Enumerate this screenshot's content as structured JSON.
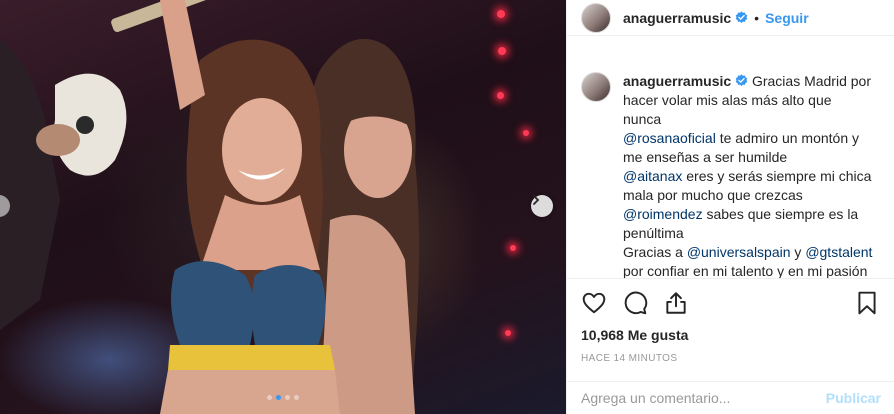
{
  "post": {
    "image_alt": "Concert photo",
    "carousel": {
      "total_dots": 4,
      "active_index": 1
    }
  },
  "header": {
    "username": "anaguerramusic",
    "separator": "•",
    "follow_label": "Seguir"
  },
  "caption": {
    "username": "anaguerramusic",
    "line1": "Gracias Madrid por",
    "line2": "hacer volar mis alas más alto que",
    "line3": "nunca",
    "mention1": "@rosanaoficial",
    "line4_rest": " te admiro un montón y",
    "line5": "me enseñas a ser humilde",
    "mention2": "@aitanax",
    "line6_rest": " eres y serás siempre mi chica",
    "line7": "mala por mucho que crezcas",
    "mention3": "@roimendez",
    "line8_rest": " sabes que siempre es la",
    "line9": "penúltima",
    "line10_pre": "Gracias a ",
    "mention4": "@universalspain",
    "line10_mid": " y ",
    "mention5": "@gtstalent",
    "line11": "por confiar en mi talento y en mi pasión"
  },
  "stats": {
    "likes": "10,968 Me gusta",
    "time": "HACE 14 MINUTOS"
  },
  "comment": {
    "placeholder": "Agrega un comentario...",
    "publish_label": "Publicar"
  },
  "icons": {
    "like": "heart-icon",
    "comment": "comment-icon",
    "share": "share-icon",
    "save": "bookmark-icon",
    "verified": "verified-badge-icon",
    "next": "chevron-right-icon"
  },
  "colors": {
    "link": "#3897f0",
    "mention": "#003569",
    "muted": "#999999",
    "publish_disabled": "#b2dffc"
  }
}
